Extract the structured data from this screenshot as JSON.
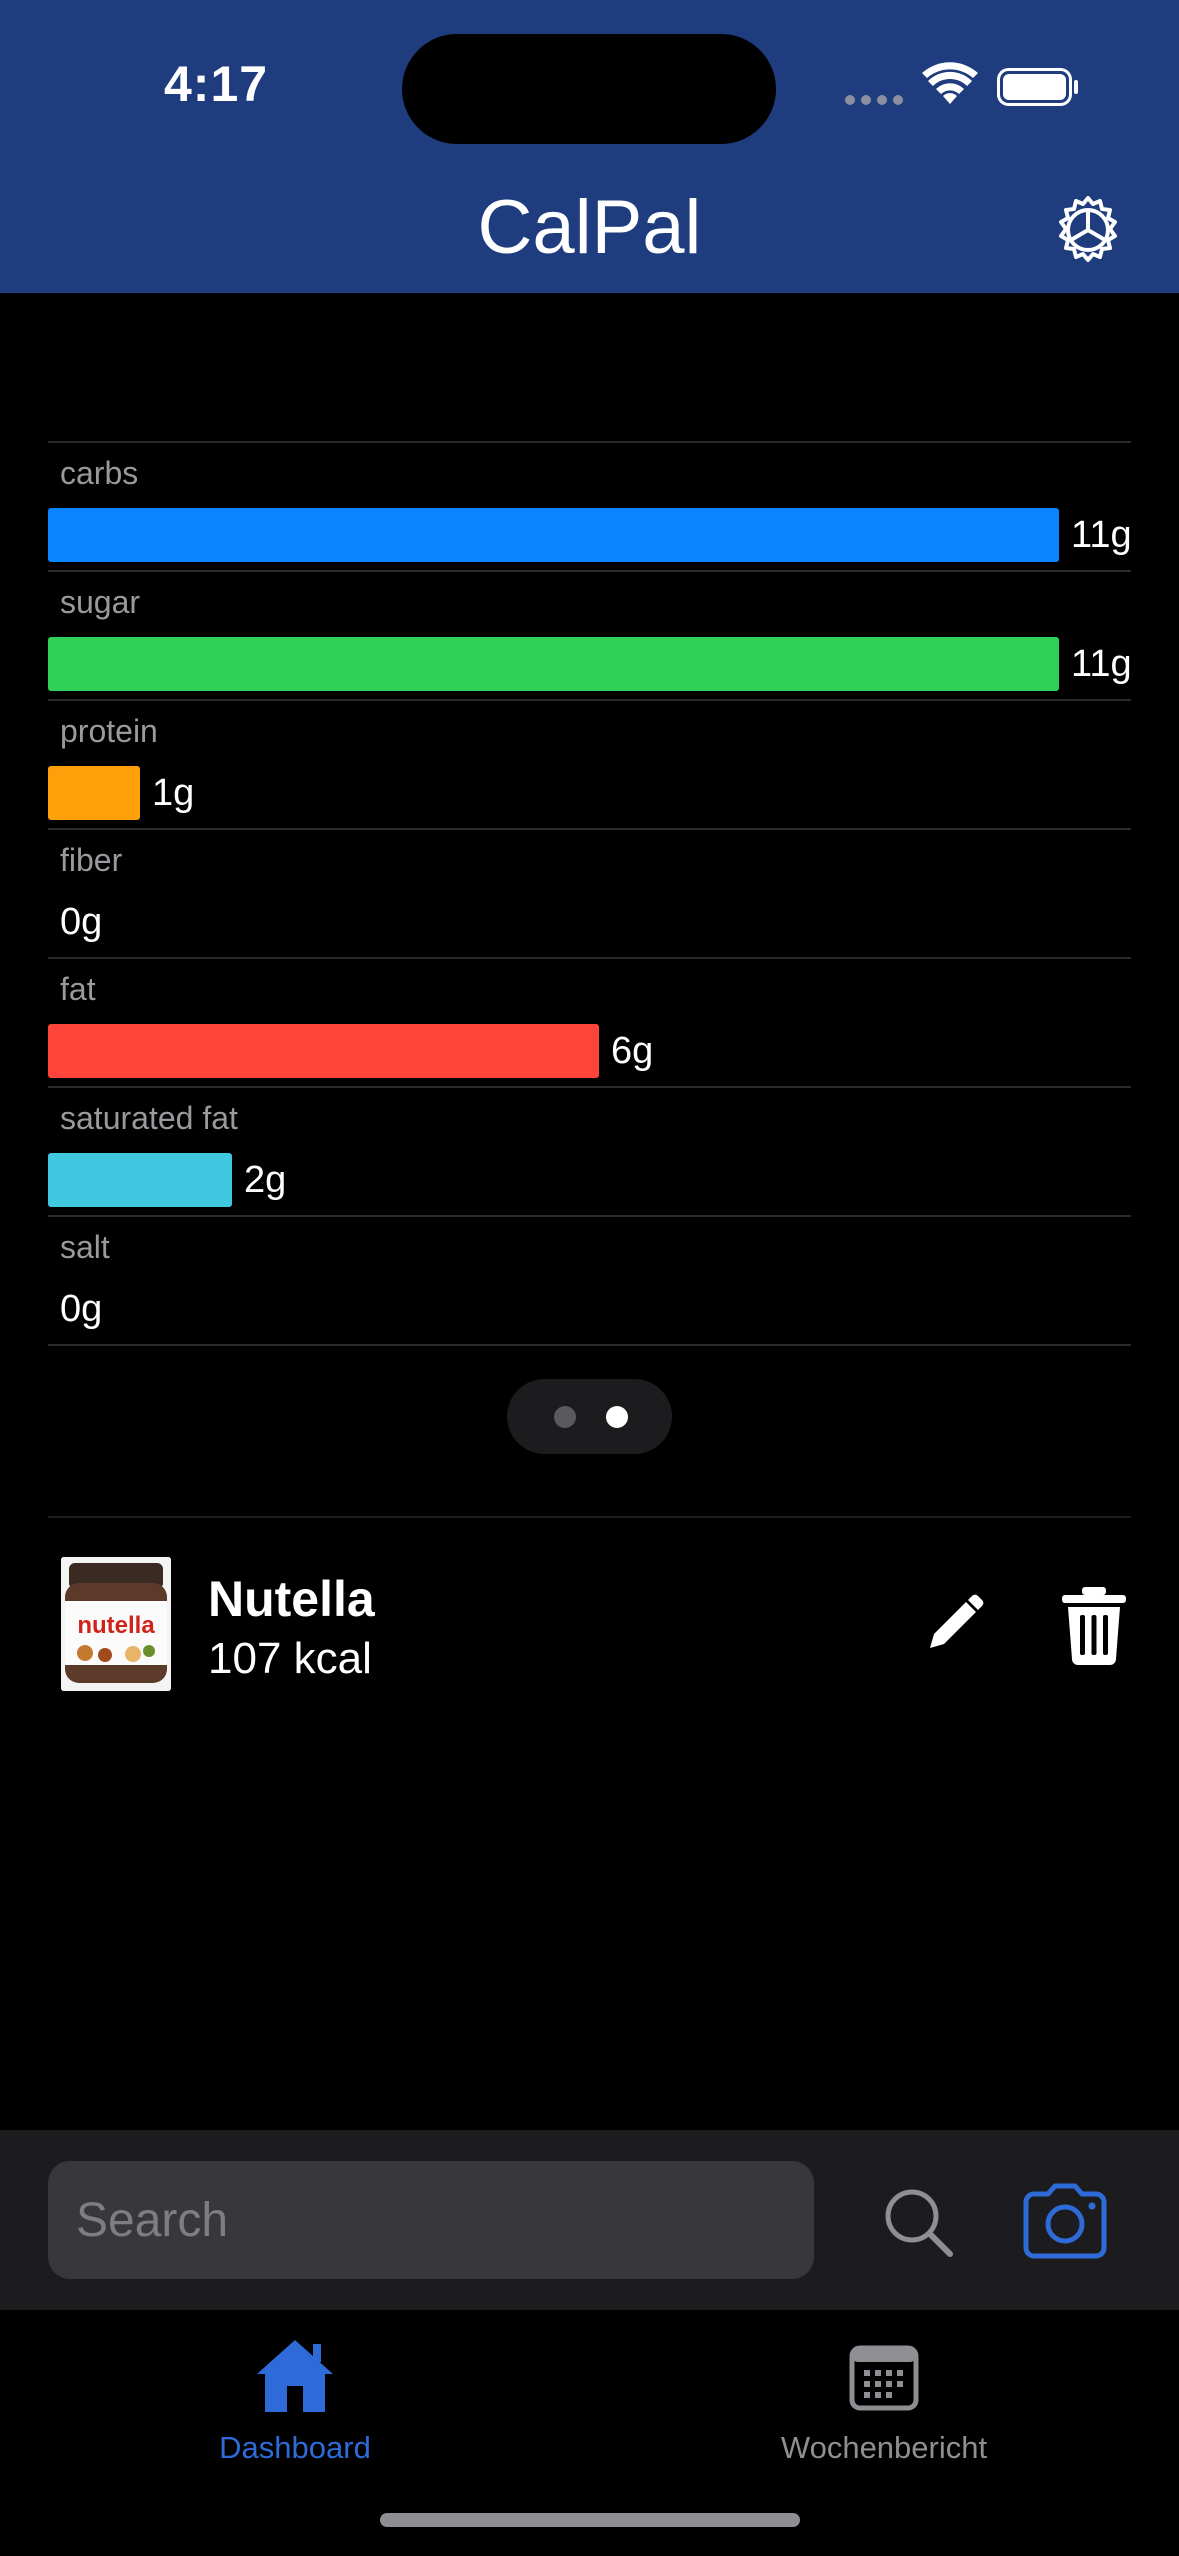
{
  "status_bar": {
    "time": "4:17"
  },
  "header": {
    "title": "CalPal",
    "settings_icon": "gear-icon"
  },
  "nutrients": [
    {
      "label": "carbs",
      "value": "11g",
      "fraction": 1.0,
      "color": "#0a84ff"
    },
    {
      "label": "sugar",
      "value": "11g",
      "fraction": 1.0,
      "color": "#30d158"
    },
    {
      "label": "protein",
      "value": "1g",
      "fraction": 0.091,
      "color": "#ff9f0a"
    },
    {
      "label": "fiber",
      "value": "0g",
      "fraction": 0.0,
      "color": "#8e8e93"
    },
    {
      "label": "fat",
      "value": "6g",
      "fraction": 0.545,
      "color": "#ff453a"
    },
    {
      "label": "saturated fat",
      "value": "2g",
      "fraction": 0.182,
      "color": "#40c8e0"
    },
    {
      "label": "salt",
      "value": "0g",
      "fraction": 0.0,
      "color": "#8e8e93"
    }
  ],
  "pager": {
    "pages": 2,
    "current": 2
  },
  "food_items": [
    {
      "name": "Nutella",
      "calories": "107 kcal",
      "thumb_text": "nutella"
    }
  ],
  "search": {
    "placeholder": "Search",
    "search_icon": "magnifier-icon",
    "camera_icon": "camera-icon"
  },
  "tabs": [
    {
      "label": "Dashboard",
      "icon": "home-icon",
      "active": true
    },
    {
      "label": "Wochenbericht",
      "icon": "calendar-icon",
      "active": false
    }
  ],
  "colors": {
    "header_bg": "#1e3c7e",
    "accent": "#2f6bd8",
    "inactive_tab": "#8e8e93"
  }
}
